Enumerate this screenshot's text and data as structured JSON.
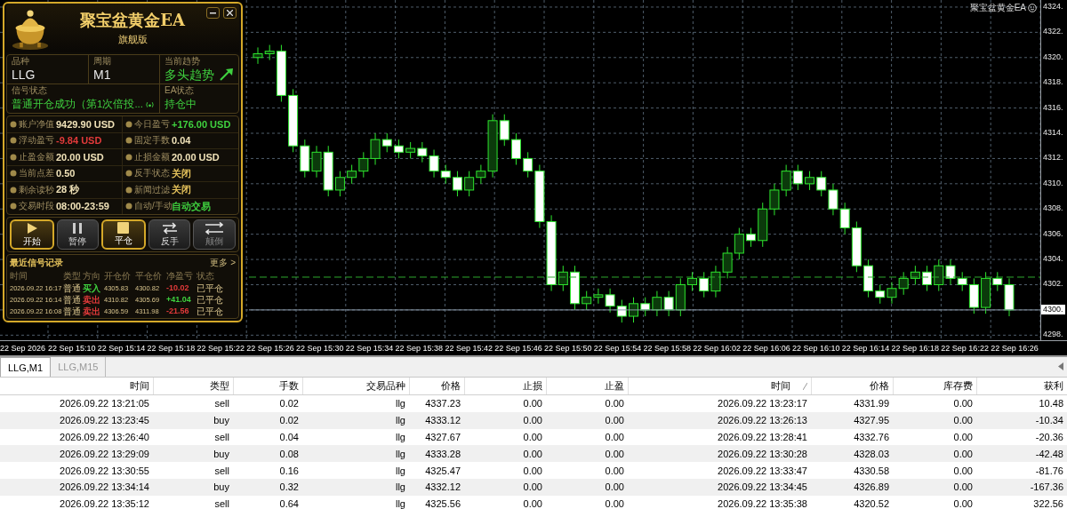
{
  "chart": {
    "symbol_label": "聚宝盆黄金EA",
    "price_tag": "4300.",
    "x_labels": [
      "22 Sep 2026",
      "22 Sep 15:10",
      "22 Sep 15:14",
      "22 Sep 15:18",
      "22 Sep 15:22",
      "22 Sep 15:26",
      "22 Sep 15:30",
      "22 Sep 15:34",
      "22 Sep 15:38",
      "22 Sep 15:42",
      "22 Sep 15:46",
      "22 Sep 15:50",
      "22 Sep 15:54",
      "22 Sep 15:58",
      "22 Sep 16:02",
      "22 Sep 16:06",
      "22 Sep 16:10",
      "22 Sep 16:14",
      "22 Sep 16:18",
      "22 Sep 16:22",
      "22 Sep 16:26"
    ],
    "chart_data": {
      "type": "candlestick",
      "ylim": [
        4297.6,
        4324.56
      ],
      "grid": true,
      "yticks": [
        {
          "value": 4324,
          "label": "4324."
        },
        {
          "value": 4322,
          "label": "4322."
        },
        {
          "value": 4320,
          "label": "4320."
        },
        {
          "value": 4318,
          "label": "4318."
        },
        {
          "value": 4316,
          "label": "4316."
        },
        {
          "value": 4314,
          "label": "4314."
        },
        {
          "value": 4312,
          "label": "4312."
        },
        {
          "value": 4310,
          "label": "4310."
        },
        {
          "value": 4308,
          "label": "4308."
        },
        {
          "value": 4306,
          "label": "4306."
        },
        {
          "value": 4304,
          "label": "4304."
        },
        {
          "value": 4302,
          "label": "4302."
        },
        {
          "value": 4298,
          "label": "4298."
        }
      ],
      "categories": [
        null,
        null,
        null,
        null,
        null,
        null,
        null,
        null,
        null,
        null,
        null,
        null,
        null,
        null,
        null,
        null,
        null,
        null,
        null,
        null,
        null,
        null,
        null,
        null,
        null,
        null,
        null,
        null,
        null,
        null,
        null,
        null,
        null,
        null,
        null,
        null,
        null,
        null,
        null,
        null,
        null,
        null,
        null,
        null,
        null,
        null,
        null,
        null,
        null,
        null,
        null,
        null,
        null,
        null,
        null,
        null,
        null,
        null,
        null,
        null,
        null,
        null,
        null,
        null,
        null
      ],
      "ohlc": [
        [
          4320,
          4320.8,
          4319.5,
          4320.3
        ],
        [
          4320.3,
          4321,
          4319.8,
          4320.5
        ],
        [
          4320.5,
          4321,
          4316.5,
          4317
        ],
        [
          4317,
          4317.5,
          4312.5,
          4313
        ],
        [
          4313,
          4313.5,
          4310.5,
          4311
        ],
        [
          4311,
          4313,
          4310.5,
          4312.5
        ],
        [
          4312.5,
          4313,
          4309,
          4309.5
        ],
        [
          4309.5,
          4311,
          4309,
          4310.5
        ],
        [
          4310.5,
          4311.5,
          4310,
          4311
        ],
        [
          4311,
          4312.5,
          4310.5,
          4312
        ],
        [
          4312,
          4314,
          4311.5,
          4313.5
        ],
        [
          4313.5,
          4314,
          4312.5,
          4313
        ],
        [
          4313,
          4313.5,
          4312,
          4312.5
        ],
        [
          4312.5,
          4313.3,
          4312,
          4312.8
        ],
        [
          4312.8,
          4313.3,
          4311.7,
          4312.2
        ],
        [
          4312.2,
          4312.7,
          4310.5,
          4311
        ],
        [
          4311,
          4311.5,
          4310,
          4310.5
        ],
        [
          4310.5,
          4311,
          4309,
          4309.5
        ],
        [
          4309.5,
          4311,
          4309,
          4310.5
        ],
        [
          4310.5,
          4311.5,
          4310,
          4311
        ],
        [
          4311,
          4315.5,
          4310.5,
          4315
        ],
        [
          4315,
          4315.5,
          4313,
          4313.5
        ],
        [
          4313.5,
          4314,
          4311.5,
          4312
        ],
        [
          4312,
          4312.5,
          4310.5,
          4311
        ],
        [
          4311,
          4311.5,
          4306.5,
          4307
        ],
        [
          4307,
          4307.5,
          4301.5,
          4302
        ],
        [
          4302,
          4303.5,
          4301.5,
          4303
        ],
        [
          4303,
          4303.5,
          4300,
          4300.5
        ],
        [
          4300.5,
          4301.5,
          4300,
          4301
        ],
        [
          4301,
          4301.7,
          4300.5,
          4301.2
        ],
        [
          4301.2,
          4301.7,
          4299.8,
          4300.3
        ],
        [
          4300.3,
          4300.8,
          4299,
          4299.5
        ],
        [
          4299.5,
          4301,
          4299,
          4300.5
        ],
        [
          4300.5,
          4301,
          4299.5,
          4300
        ],
        [
          4300,
          4301.5,
          4299.5,
          4301
        ],
        [
          4301,
          4301.5,
          4299.5,
          4300
        ],
        [
          4300,
          4302.5,
          4299.5,
          4302
        ],
        [
          4302,
          4303,
          4301.5,
          4302.5
        ],
        [
          4302.5,
          4303,
          4301,
          4301.5
        ],
        [
          4301.5,
          4303.5,
          4301,
          4303
        ],
        [
          4303,
          4305,
          4302.5,
          4304.5
        ],
        [
          4304.5,
          4306.5,
          4304,
          4306
        ],
        [
          4306,
          4306.5,
          4305,
          4305.5
        ],
        [
          4305.5,
          4308.5,
          4305,
          4308
        ],
        [
          4308,
          4310,
          4307.5,
          4309.5
        ],
        [
          4309.5,
          4311.5,
          4309,
          4311
        ],
        [
          4311,
          4311.5,
          4309.5,
          4310
        ],
        [
          4310,
          4311,
          4309.5,
          4310.5
        ],
        [
          4310.5,
          4311,
          4309,
          4309.5
        ],
        [
          4309.5,
          4310,
          4307.5,
          4308
        ],
        [
          4308,
          4308.5,
          4306,
          4306.5
        ],
        [
          4306.5,
          4307,
          4303,
          4303.5
        ],
        [
          4303.5,
          4304,
          4301,
          4301.5
        ],
        [
          4301.5,
          4302,
          4300.5,
          4301
        ],
        [
          4301,
          4302.2,
          4300.5,
          4301.7
        ],
        [
          4301.7,
          4303,
          4301.2,
          4302.5
        ],
        [
          4302.5,
          4303.5,
          4302,
          4303
        ],
        [
          4303,
          4303.5,
          4301.5,
          4302
        ],
        [
          4302,
          4304,
          4301.5,
          4303.5
        ],
        [
          4303.5,
          4304,
          4302,
          4302.5
        ],
        [
          4302.5,
          4303,
          4301.5,
          4302
        ],
        [
          4302,
          4302.5,
          4299.7,
          4300.2
        ],
        [
          4300.2,
          4303,
          4299.7,
          4302.5
        ],
        [
          4302.5,
          4303,
          4301.5,
          4302
        ],
        [
          4302,
          4302.5,
          4299.5,
          4300
        ]
      ]
    }
  },
  "ea_panel": {
    "title": "聚宝盆黄金EA",
    "subtitle": "旗舰版",
    "info": [
      {
        "label": "品种",
        "value": "LLG",
        "color": "#e8e8e8"
      },
      {
        "label": "周期",
        "value": "M1",
        "color": "#e8e8e8"
      },
      {
        "label": "当前趋势",
        "value": "多头趋势",
        "color": "#3fd13f"
      }
    ],
    "signal": {
      "label": "信号状态",
      "value": "普通开仓成功（第1次倍投..."
    },
    "ea_status": {
      "label": "EA状态",
      "value": "持仓中"
    },
    "stats": [
      {
        "label": "账户净值",
        "value": "9429.90 USD",
        "color": "#f0e2b8"
      },
      {
        "label": "今日盈亏",
        "value": "+176.00 USD",
        "color": "#3fd13f"
      },
      {
        "label": "浮动盈亏",
        "value": "-9.84 USD",
        "color": "#e23a3a"
      },
      {
        "label": "固定手数",
        "value": "0.04",
        "color": "#f0e2b8"
      },
      {
        "label": "止盈金额",
        "value": "20.00 USD",
        "color": "#f0e2b8"
      },
      {
        "label": "止损金额",
        "value": "20.00 USD",
        "color": "#f0e2b8"
      },
      {
        "label": "当前点差",
        "value": "0.50",
        "color": "#f0e2b8"
      },
      {
        "label": "反手状态",
        "value": "关闭",
        "color": "#e6c35c"
      },
      {
        "label": "剩余读秒",
        "value": "28 秒",
        "color": "#f0e2b8"
      },
      {
        "label": "新闻过滤",
        "value": "关闭",
        "color": "#e6c35c"
      },
      {
        "label": "交易时段",
        "value": "08:00-23:59",
        "color": "#f0e2b8"
      },
      {
        "label": "自动/手动",
        "value": "自动交易",
        "color": "#3fd13f"
      }
    ],
    "buttons": [
      {
        "label": "开始",
        "kind": "play",
        "highlighted": true,
        "disabled": false
      },
      {
        "label": "暂停",
        "kind": "pause",
        "highlighted": false,
        "disabled": false
      },
      {
        "label": "平仓",
        "kind": "stop",
        "highlighted": true,
        "disabled": false
      },
      {
        "label": "反手",
        "kind": "swap",
        "highlighted": false,
        "disabled": false
      },
      {
        "label": "颠倒",
        "kind": "reverse",
        "highlighted": false,
        "disabled": true
      }
    ],
    "records": {
      "title": "最近信号记录",
      "more": "更多 >",
      "columns": [
        "时间",
        "类型",
        "方向",
        "开仓价",
        "平仓价",
        "净盈亏",
        "状态"
      ],
      "rows": [
        {
          "time": "2026.09.22 16:17",
          "type": "普通",
          "direction": {
            "text": "买入",
            "color": "#3fd13f"
          },
          "open": "4305.83",
          "close": "4300.82",
          "pnl": {
            "text": "-10.02",
            "color": "#e23a3a"
          },
          "status": "已平仓"
        },
        {
          "time": "2026.09.22 16:14",
          "type": "普通",
          "direction": {
            "text": "卖出",
            "color": "#e23a3a"
          },
          "open": "4310.82",
          "close": "4305.69",
          "pnl": {
            "text": "+41.04",
            "color": "#3fd13f"
          },
          "status": "已平仓"
        },
        {
          "time": "2026.09.22 16:08",
          "type": "普通",
          "direction": {
            "text": "卖出",
            "color": "#e23a3a"
          },
          "open": "4306.59",
          "close": "4311.98",
          "pnl": {
            "text": "-21.56",
            "color": "#e23a3a"
          },
          "status": "已平仓"
        }
      ]
    }
  },
  "tabs": [
    {
      "label": "LLG,M1",
      "selected": true
    },
    {
      "label": "LLG,M15",
      "selected": false
    }
  ],
  "table": {
    "columns": [
      {
        "label": "时间",
        "sorted": false
      },
      {
        "label": "类型",
        "sorted": false
      },
      {
        "label": "手数",
        "sorted": false
      },
      {
        "label": "交易品种",
        "sorted": false
      },
      {
        "label": "价格",
        "sorted": false
      },
      {
        "label": "止损",
        "sorted": false
      },
      {
        "label": "止盈",
        "sorted": false
      },
      {
        "label": "时间",
        "sorted": true
      },
      {
        "label": "价格",
        "sorted": false
      },
      {
        "label": "库存费",
        "sorted": false
      },
      {
        "label": "获利",
        "sorted": false
      }
    ],
    "rows": [
      [
        "2026.09.22 13:21:05",
        "sell",
        "0.02",
        "llg",
        "4337.23",
        "0.00",
        "0.00",
        "2026.09.22 13:23:17",
        "4331.99",
        "0.00",
        "10.48"
      ],
      [
        "2026.09.22 13:23:45",
        "buy",
        "0.02",
        "llg",
        "4333.12",
        "0.00",
        "0.00",
        "2026.09.22 13:26:13",
        "4327.95",
        "0.00",
        "-10.34"
      ],
      [
        "2026.09.22 13:26:40",
        "sell",
        "0.04",
        "llg",
        "4327.67",
        "0.00",
        "0.00",
        "2026.09.22 13:28:41",
        "4332.76",
        "0.00",
        "-20.36"
      ],
      [
        "2026.09.22 13:29:09",
        "buy",
        "0.08",
        "llg",
        "4333.28",
        "0.00",
        "0.00",
        "2026.09.22 13:30:28",
        "4328.03",
        "0.00",
        "-42.48"
      ],
      [
        "2026.09.22 13:30:55",
        "sell",
        "0.16",
        "llg",
        "4325.47",
        "0.00",
        "0.00",
        "2026.09.22 13:33:47",
        "4330.58",
        "0.00",
        "-81.76"
      ],
      [
        "2026.09.22 13:34:14",
        "buy",
        "0.32",
        "llg",
        "4332.12",
        "0.00",
        "0.00",
        "2026.09.22 13:34:45",
        "4326.89",
        "0.00",
        "-167.36"
      ],
      [
        "2026.09.22 13:35:12",
        "sell",
        "0.64",
        "llg",
        "4325.56",
        "0.00",
        "0.00",
        "2026.09.22 13:35:38",
        "4320.52",
        "0.00",
        "322.56"
      ]
    ]
  }
}
